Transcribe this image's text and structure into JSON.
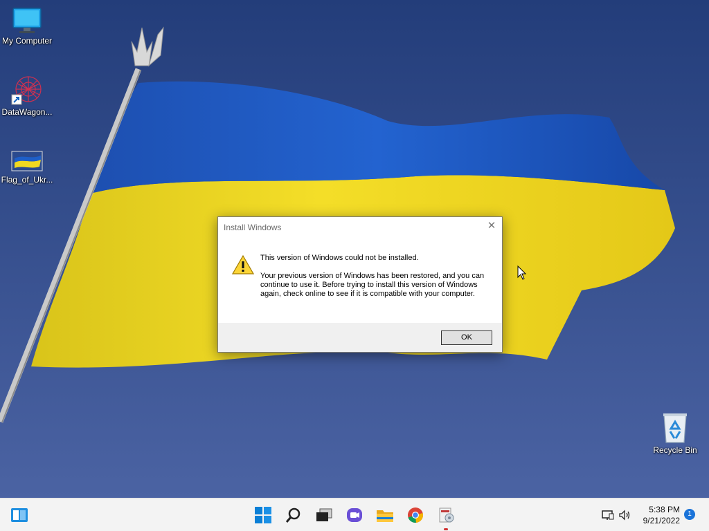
{
  "desktop": {
    "icons": [
      {
        "label": "My Computer",
        "icon": "monitor-icon"
      },
      {
        "label": "DataWagon...",
        "icon": "datawagon-shortcut-icon"
      },
      {
        "label": "Flag_of_Ukr...",
        "icon": "image-file-icon"
      },
      {
        "label": "Recycle Bin",
        "icon": "recycle-bin-icon"
      }
    ],
    "wallpaper": "ukraine-flag",
    "colors": {
      "sky": "#2d4a8e",
      "flag_blue": "#1b57c0",
      "flag_yellow": "#f2dc1e"
    }
  },
  "dialog": {
    "title": "Install Windows",
    "heading": "This version of Windows could not be installed.",
    "body": "Your previous version of Windows has been restored, and you can continue to use it.  Before trying to install this version of Windows again, check online to see if it is compatible with your computer.",
    "ok_label": "OK",
    "icon": "warning-icon"
  },
  "taskbar": {
    "apps": [
      "start",
      "search",
      "task-view",
      "chat",
      "file-explorer",
      "chrome",
      "setup"
    ],
    "time": "5:38 PM",
    "date": "9/21/2022",
    "notification_count": "1"
  }
}
